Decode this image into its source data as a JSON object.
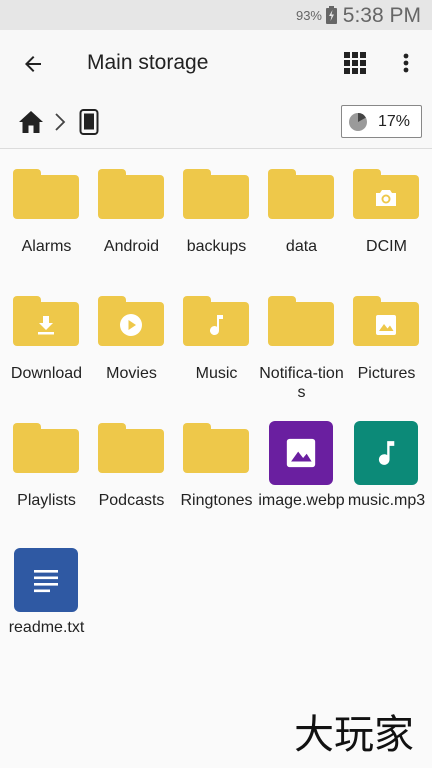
{
  "status_bar": {
    "battery_percent": "93%",
    "time": "5:38 PM"
  },
  "app_bar": {
    "title": "Main storage",
    "back_icon": "arrow-back-icon",
    "view_icon": "grid-view-icon",
    "menu_icon": "more-vertical-icon"
  },
  "breadcrumb": {
    "home_icon": "home-icon",
    "separator_icon": "chevron-right-icon",
    "device_icon": "phone-icon"
  },
  "storage": {
    "used_label": "17%",
    "used_fraction": 0.17
  },
  "items": [
    {
      "label": "Alarms",
      "kind": "folder",
      "glyph": ""
    },
    {
      "label": "Android",
      "kind": "folder",
      "glyph": ""
    },
    {
      "label": "backups",
      "kind": "folder",
      "glyph": ""
    },
    {
      "label": "data",
      "kind": "folder",
      "glyph": ""
    },
    {
      "label": "DCIM",
      "kind": "folder",
      "glyph": "camera-icon"
    },
    {
      "label": "Download",
      "kind": "folder",
      "glyph": "download-icon"
    },
    {
      "label": "Movies",
      "kind": "folder",
      "glyph": "play-icon"
    },
    {
      "label": "Music",
      "kind": "folder",
      "glyph": "music-note-icon"
    },
    {
      "label": "Notifica-tions",
      "kind": "folder",
      "glyph": ""
    },
    {
      "label": "Pictures",
      "kind": "folder",
      "glyph": "image-icon"
    },
    {
      "label": "Playlists",
      "kind": "folder",
      "glyph": ""
    },
    {
      "label": "Podcasts",
      "kind": "folder",
      "glyph": ""
    },
    {
      "label": "Ringtones",
      "kind": "folder",
      "glyph": ""
    },
    {
      "label": "image.webp",
      "kind": "file",
      "glyph": "image-icon",
      "color": "#6a1fa0"
    },
    {
      "label": "music.mp3",
      "kind": "file",
      "glyph": "music-note-icon",
      "color": "#0c8a78"
    },
    {
      "label": "readme.txt",
      "kind": "file",
      "glyph": "text-doc-icon",
      "color": "#2f59a3"
    }
  ],
  "colors": {
    "folder": "#eec84a",
    "folder_glyph": "#ffffff"
  },
  "watermark": {
    "text": "大玩家"
  }
}
